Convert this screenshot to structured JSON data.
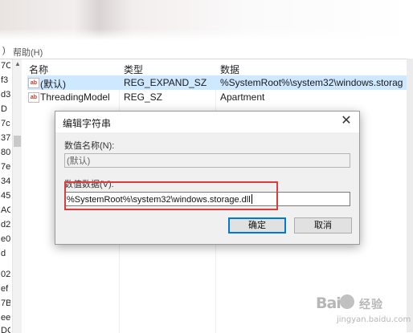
{
  "menubar": {
    "paren": ")",
    "help": "帮助(H)"
  },
  "tree_fragments": [
    "7C",
    "f3",
    "d3",
    "D",
    "7c",
    "37",
    "80",
    "7e",
    "34",
    "45",
    "AC",
    "d2",
    "e0",
    "d",
    "02",
    "ef",
    "7B",
    "ee",
    "DC"
  ],
  "list": {
    "columns": [
      "名称",
      "类型",
      "数据"
    ],
    "rows": [
      {
        "icon": "string-value-icon",
        "icon_text": "ab",
        "name": "(默认)",
        "type": "REG_EXPAND_SZ",
        "data": "%SystemRoot%\\system32\\windows.storag",
        "selected": true
      },
      {
        "icon": "string-value-icon",
        "icon_text": "ab",
        "name": "ThreadingModel",
        "type": "REG_SZ",
        "data": "Apartment",
        "selected": false
      }
    ]
  },
  "dialog": {
    "title": "编辑字符串",
    "close_glyph": "✕",
    "value_name_label": "数值名称(N):",
    "value_name": "(默认)",
    "value_data_label": "数值数据(V):",
    "value_data": "%SystemRoot%\\system32\\windows.storage.dll",
    "ok_label": "确定",
    "cancel_label": "取消"
  },
  "highlight": {
    "color": "#e03a3a"
  },
  "colors": {
    "selection": "#cde8ff",
    "dialog_bg": "#f0f0f0",
    "default_button_border": "#0078d7"
  },
  "watermark": {
    "logo": "Bai",
    "name": "经验",
    "url": "jingyan.baidu.com"
  }
}
